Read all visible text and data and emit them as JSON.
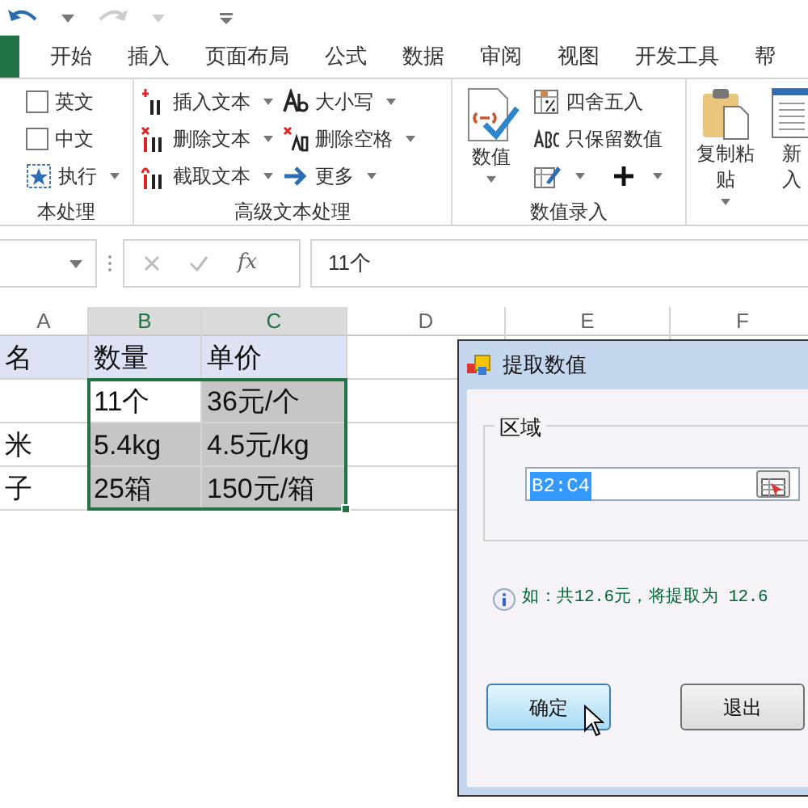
{
  "tabs": [
    {
      "label": "开始",
      "selected": false
    },
    {
      "label": "插入",
      "selected": false
    },
    {
      "label": "页面布局",
      "selected": false
    },
    {
      "label": "公式",
      "selected": false
    },
    {
      "label": "数据",
      "selected": false
    },
    {
      "label": "审阅",
      "selected": false
    },
    {
      "label": "视图",
      "selected": false
    },
    {
      "label": "开发工具",
      "selected": false
    },
    {
      "label": "帮",
      "selected": false
    }
  ],
  "ribbon": [
    {
      "label": "本处理",
      "columns": [
        [
          {
            "kind": "checkbox",
            "label": "英文",
            "checked": false
          },
          {
            "kind": "checkbox",
            "label": "中文",
            "checked": false
          },
          {
            "kind": "small",
            "label": "执行",
            "dropdown": true
          }
        ]
      ]
    },
    {
      "label": "高级文本处理",
      "columns": [
        [
          {
            "kind": "small",
            "label": "插入文本",
            "dropdown": true
          },
          {
            "kind": "small",
            "label": "删除文本",
            "dropdown": true
          },
          {
            "kind": "small",
            "label": "截取文本",
            "dropdown": true
          }
        ],
        [
          {
            "kind": "small",
            "label": "大小写",
            "dropdown": true
          },
          {
            "kind": "small",
            "label": "删除空格",
            "dropdown": true
          },
          {
            "kind": "small",
            "label": "更多",
            "dropdown": true
          }
        ]
      ]
    },
    {
      "label": "数值录入",
      "columns": [
        [
          {
            "kind": "large",
            "lines": [
              "数值"
            ],
            "dropdown": true
          }
        ],
        [
          {
            "kind": "small",
            "label": "四舍五入",
            "dropdown": false
          },
          {
            "kind": "small",
            "label": "只保留数值",
            "dropdown": false
          },
          {
            "kind": "icons",
            "items": [
              {
                "dropdown": true
              },
              {
                "dropdown": true
              }
            ]
          }
        ]
      ]
    },
    {
      "columns": [
        [
          {
            "kind": "large",
            "lines": [
              "复制粘",
              "贴"
            ],
            "dropdown": true
          }
        ],
        [
          {
            "kind": "large",
            "lines": [
              "新",
              "入"
            ],
            "dropdown": false
          }
        ]
      ]
    }
  ],
  "formula_bar": {
    "function_label": "fx",
    "value": "11个"
  },
  "columns": [
    {
      "label": "A",
      "selected": false
    },
    {
      "label": "B",
      "selected": true
    },
    {
      "label": "C",
      "selected": true
    },
    {
      "label": "D",
      "selected": false
    },
    {
      "label": "E",
      "selected": false
    },
    {
      "label": "F",
      "selected": false
    }
  ],
  "rows": [
    {
      "header": true,
      "cells": [
        {
          "text": "名",
          "selected": false
        },
        {
          "text": "数量",
          "selected": false
        },
        {
          "text": "单价",
          "selected": false
        }
      ]
    },
    {
      "header": false,
      "cells": [
        {
          "selected": false
        },
        {
          "text": "11个",
          "selected": true,
          "active": true
        },
        {
          "text": "36元/个",
          "selected": true,
          "active": false
        }
      ]
    },
    {
      "header": false,
      "cells": [
        {
          "text": "米",
          "selected": false
        },
        {
          "text": "5.4kg",
          "selected": true,
          "active": false
        },
        {
          "text": "4.5元/kg",
          "selected": true,
          "active": false
        }
      ]
    },
    {
      "header": false,
      "cells": [
        {
          "text": "子",
          "selected": false
        },
        {
          "text": "25箱",
          "selected": true,
          "active": false
        },
        {
          "text": "150元/箱",
          "selected": true,
          "active": false
        }
      ]
    }
  ],
  "dialog": {
    "title": "提取数值",
    "group_label": "区域",
    "range_value": "B2:C4",
    "value_selected": true,
    "hint": "如：共12.6元，将提取为 12.6",
    "buttons": [
      {
        "label": "确定",
        "focused": true
      },
      {
        "label": "退出",
        "focused": false
      }
    ]
  }
}
